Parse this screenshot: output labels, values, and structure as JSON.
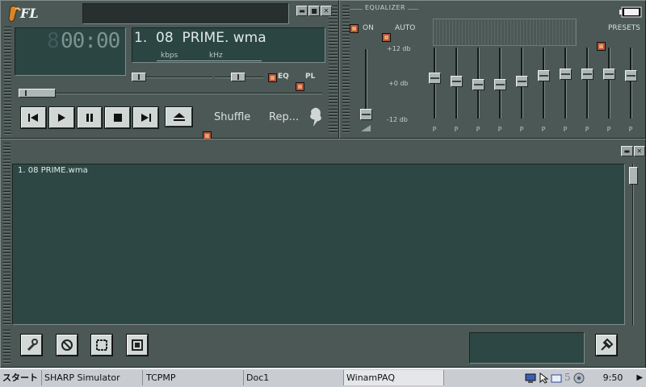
{
  "app": {
    "logo_text": "FL"
  },
  "player": {
    "time_display": "00:00",
    "time_ghost_digit": "8",
    "track_title": "1.  08  PRIME. wma",
    "kbps_label": "kbps",
    "khz_label": "kHz",
    "eq_toggle_label": "EQ",
    "pl_toggle_label": "PL",
    "shuffle_label": "Shuffle",
    "repeat_label": "Rep..."
  },
  "equalizer": {
    "title": "EQUALIZER",
    "on_label": "ON",
    "auto_label": "AUTO",
    "presets_label": "PRESETS",
    "db_top": "+12 db",
    "db_mid": "+0 db",
    "db_bottom": "-12 db",
    "band_label": "P",
    "preamp_level": -1.0,
    "bands": [
      0.15,
      0.05,
      -0.05,
      -0.05,
      0.05,
      0.25,
      0.3,
      0.3,
      0.3,
      0.25
    ]
  },
  "playlist": {
    "items": [
      "1. 08 PRIME.wma"
    ]
  },
  "taskbar": {
    "start_label": "スタート",
    "tasks": [
      "SHARP Simulator",
      "TCPMP",
      "Doc1",
      "WinamPAQ"
    ],
    "clock": "9:50",
    "tray_num": "5"
  },
  "colors": {
    "lcd_text": "#dfe9e6",
    "accent_checkbox": "#b9523b",
    "panel": "#4b5856"
  }
}
